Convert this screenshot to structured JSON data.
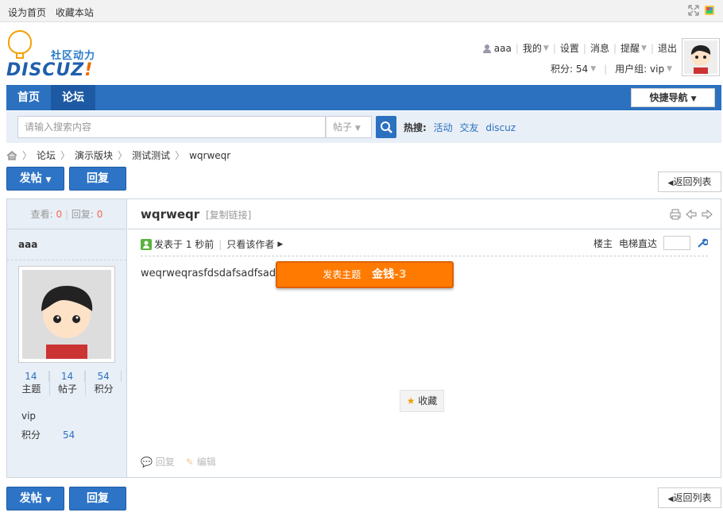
{
  "topbar": {
    "set_home": "设为首页",
    "bookmark": "收藏本站"
  },
  "logo": {
    "tagline": "社区动力",
    "word": "DISCUZ",
    "mark": "!"
  },
  "user": {
    "name": "aaa",
    "my": "我的",
    "settings": "设置",
    "messages": "消息",
    "reminders": "提醒",
    "logout": "退出",
    "points": "积分: 54",
    "group": "用户组: vip"
  },
  "nav": {
    "home": "首页",
    "forum": "论坛",
    "quick_nav": "快捷导航"
  },
  "search": {
    "placeholder": "请输入搜索内容",
    "type": "帖子",
    "hot_label": "热搜:",
    "hot": [
      "活动",
      "交友",
      "discuz"
    ]
  },
  "breadcrumb": [
    "论坛",
    "演示版块",
    "测试测试",
    "wqrweqr"
  ],
  "buttons": {
    "post": "发帖",
    "reply": "回复",
    "back": "返回列表"
  },
  "post": {
    "views_label": "查看:",
    "views": "0",
    "replies_label": "回复:",
    "replies": "0",
    "author": "aaa",
    "title": "wqrweqr",
    "copy_link": "[复制链接]",
    "posted": "发表于 1 秒前",
    "only_author": "只看该作者",
    "floor": "楼主",
    "jump": "电梯直达",
    "content": "weqrweqrasfdsdafsadfsadfsd",
    "toast_label": "发表主题",
    "toast_amount": "金钱",
    "toast_value": "-3",
    "favorite": "收藏",
    "action_reply": "回复",
    "action_edit": "编辑"
  },
  "author_stats": {
    "threads": "14",
    "threads_label": "主题",
    "posts": "14",
    "posts_label": "帖子",
    "points": "54",
    "points_label": "积分",
    "group": "vip",
    "points_row_label": "积分",
    "points_row_value": "54"
  },
  "colors": {
    "nav": "#2b71c0",
    "accent": "#ff7a00"
  }
}
